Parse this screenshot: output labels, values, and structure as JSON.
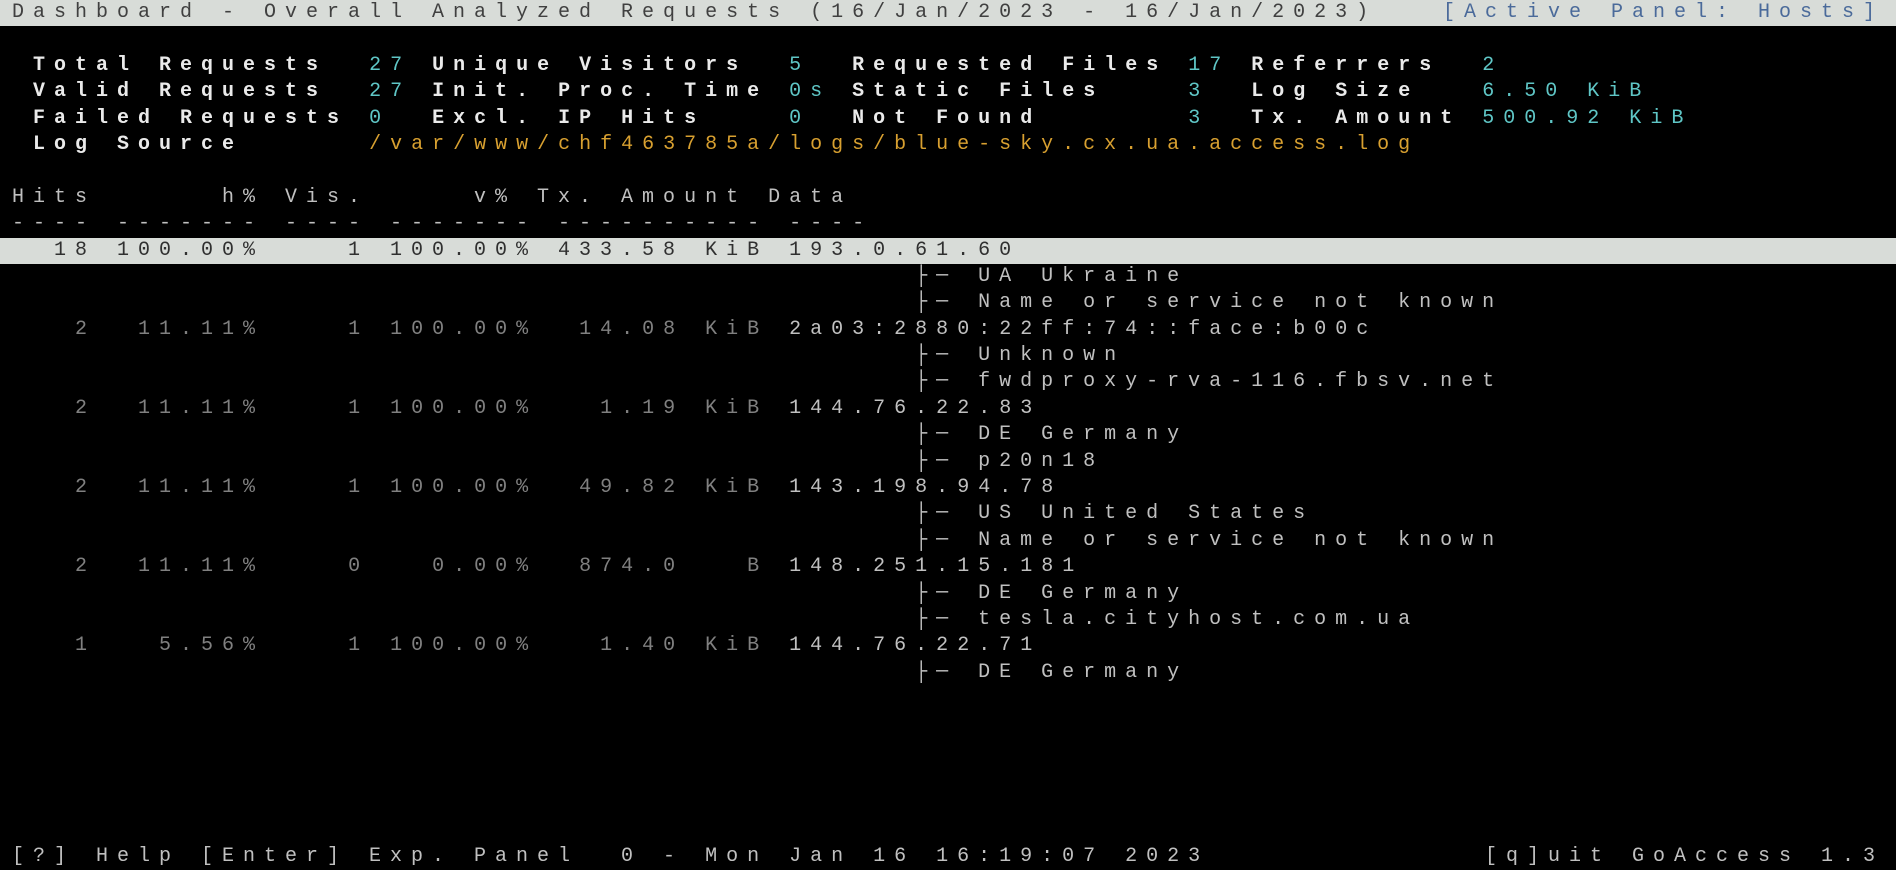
{
  "header": {
    "title": "Dashboard - Overall Analyzed Requests (16/Jan/2023 - 16/Jan/2023)",
    "active_panel": "[Active Panel: Hosts]"
  },
  "summary": {
    "r1": {
      "a_lbl": "Total Requests ",
      "a_val": "27",
      "b_lbl": "Unique Visitors ",
      "b_val": "5 ",
      "c_lbl": "Requested Files",
      "c_val": "17",
      "d_lbl": "Referrers ",
      "d_val": "2"
    },
    "r2": {
      "a_lbl": "Valid Requests ",
      "a_val": "27",
      "b_lbl": "Init. Proc. Time",
      "b_val": "0s",
      "c_lbl": "Static Files   ",
      "c_val": "3 ",
      "d_lbl": "Log Size  ",
      "d_val": "6.50 KiB"
    },
    "r3": {
      "a_lbl": "Failed Requests",
      "a_val": "0 ",
      "b_lbl": "Excl. IP Hits   ",
      "b_val": "0 ",
      "c_lbl": "Not Found      ",
      "c_val": "3 ",
      "d_lbl": "Tx. Amount",
      "d_val": "500.92 KiB"
    },
    "log_lbl": "Log Source     ",
    "log_val": "/var/www/chf463785a/logs/blue-sky.cx.ua.access.log"
  },
  "cols": "Hits      h% Vis.     v% Tx. Amount Data",
  "sep": "---- ------- ---- ------- ---------- ----",
  "rows": [
    {
      "hl": true,
      "hits": "  18",
      "hp": "100.00%",
      "vis": "   1",
      "vp": "100.00%",
      "tx": "433.58 KiB",
      "data": "193.0.61.60"
    },
    {
      "sub": "├─ UA Ukraine"
    },
    {
      "sub": "├─ Name or service not known"
    },
    {
      "hits": "   2",
      "hp": " 11.11%",
      "vis": "   1",
      "vp": "100.00%",
      "tx": " 14.08 KiB",
      "data": "2a03:2880:22ff:74::face:b00c"
    },
    {
      "sub": "├─ Unknown"
    },
    {
      "sub": "├─ fwdproxy-rva-116.fbsv.net"
    },
    {
      "hits": "   2",
      "hp": " 11.11%",
      "vis": "   1",
      "vp": "100.00%",
      "tx": "  1.19 KiB",
      "data": "144.76.22.83"
    },
    {
      "sub": "├─ DE Germany"
    },
    {
      "sub": "├─ p20n18"
    },
    {
      "hits": "   2",
      "hp": " 11.11%",
      "vis": "   1",
      "vp": "100.00%",
      "tx": " 49.82 KiB",
      "data": "143.198.94.78"
    },
    {
      "sub": "├─ US United States"
    },
    {
      "sub": "├─ Name or service not known"
    },
    {
      "hits": "   2",
      "hp": " 11.11%",
      "vis": "   0",
      "vp": "  0.00%",
      "tx": " 874.0   B",
      "data": "148.251.15.181"
    },
    {
      "sub": "├─ DE Germany"
    },
    {
      "sub": "├─ tesla.cityhost.com.ua"
    },
    {
      "hits": "   1",
      "hp": "  5.56%",
      "vis": "   1",
      "vp": "100.00%",
      "tx": "  1.40 KiB",
      "data": "144.76.22.71"
    },
    {
      "sub": "├─ DE Germany"
    }
  ],
  "footer": {
    "left": "[?] Help [Enter] Exp. Panel  0 - Mon Jan 16 16:19:07 2023",
    "right": "[q]uit GoAccess 1.3"
  }
}
